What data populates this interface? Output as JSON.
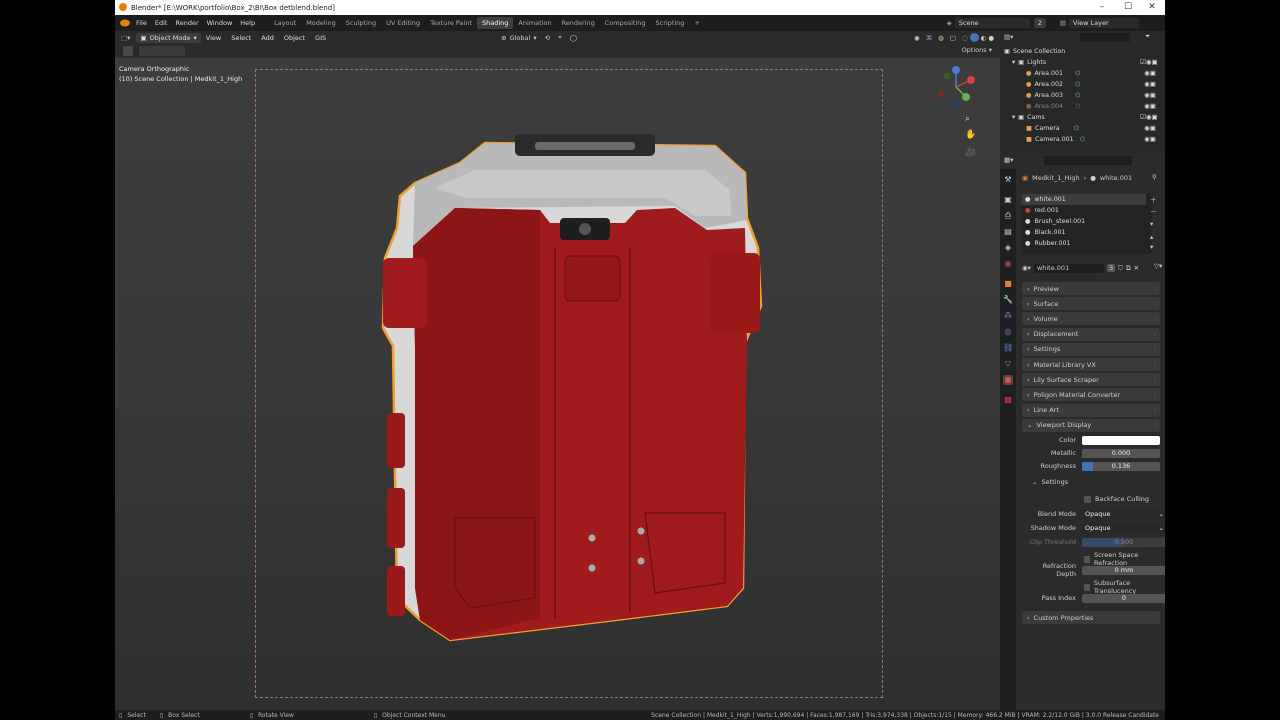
{
  "window": {
    "title": "Blender* [E:\\WORK\\portfolio\\Box_2\\BI\\Box detblend.blend]",
    "minimize": "–",
    "maximize": "☐",
    "close": "✕"
  },
  "menu": [
    "File",
    "Edit",
    "Render",
    "Window",
    "Help"
  ],
  "workspaces": [
    "Layout",
    "Modeling",
    "Sculpting",
    "UV Editing",
    "Texture Paint",
    "Shading",
    "Animation",
    "Rendering",
    "Compositing",
    "Scripting",
    "+"
  ],
  "active_workspace": "Shading",
  "scene": {
    "label": "Scene",
    "count": "2",
    "view_layer": "View Layer"
  },
  "viewport_header": {
    "mode": "Object Mode",
    "menus": [
      "View",
      "Select",
      "Add",
      "Object",
      "GIS"
    ],
    "orientation": "Global",
    "options": "Options"
  },
  "viewport": {
    "camera_label": "Camera Orthographic",
    "collection_label": "(10) Scene Collection | Medkit_1_High"
  },
  "outliner": {
    "root": "Scene Collection",
    "items": [
      {
        "label": "Lights",
        "indent": 0
      },
      {
        "label": "Area.001",
        "indent": 2
      },
      {
        "label": "Area.002",
        "indent": 2
      },
      {
        "label": "Area.003",
        "indent": 2
      },
      {
        "label": "Area.004",
        "indent": 2
      },
      {
        "label": "Cams",
        "indent": 0
      },
      {
        "label": "Camera",
        "indent": 2
      },
      {
        "label": "Camera.001",
        "indent": 2
      }
    ]
  },
  "properties": {
    "object": "Medkit_1_High",
    "material": "white.001",
    "slots": [
      "white.001",
      "red.001",
      "Brush_steel.001",
      "Black.001",
      "Rubber.001"
    ],
    "material_users": "3",
    "panels": [
      "Preview",
      "Surface",
      "Volume",
      "Displacement",
      "Settings",
      "Material Library VX",
      "Lily Surface Scraper",
      "Poligon Material Converter",
      "Line Art",
      "Viewport Display"
    ],
    "viewport_display": {
      "color_label": "Color",
      "color": "#ffffff",
      "metallic_label": "Metallic",
      "metallic": "0.000",
      "roughness_label": "Roughness",
      "roughness": "0.136",
      "roughness_value": 0.136
    },
    "settings": {
      "title": "Settings",
      "backface": "Backface Culling",
      "blend_label": "Blend Mode",
      "blend": "Opaque",
      "shadow_label": "Shadow Mode",
      "shadow": "Opaque",
      "clip_label": "Clip Threshold",
      "clip": "0.500",
      "ssr": "Screen Space Refraction",
      "refraction_label": "Refraction Depth",
      "refraction": "0 mm",
      "subsurface": "Subsurface Translucency",
      "pass_label": "Pass Index",
      "pass": "0"
    },
    "custom": "Custom Properties"
  },
  "status": {
    "select": "Select",
    "box": "Box Select",
    "rotate": "Rotate View",
    "context": "Object Context Menu",
    "stats": "Scene Collection | Medkit_1_High | Verts:1,990,694 | Faces:1,987,169 | Tris:3,974,338 | Objects:1/15 | Memory: 466.2 MiB | VRAM: 2.2/12.0 GiB | 3.0.0 Release Candidate"
  },
  "colors": {
    "accent": "#4772b3",
    "selection": "#f0a030",
    "body_red": "#a01c1c"
  }
}
